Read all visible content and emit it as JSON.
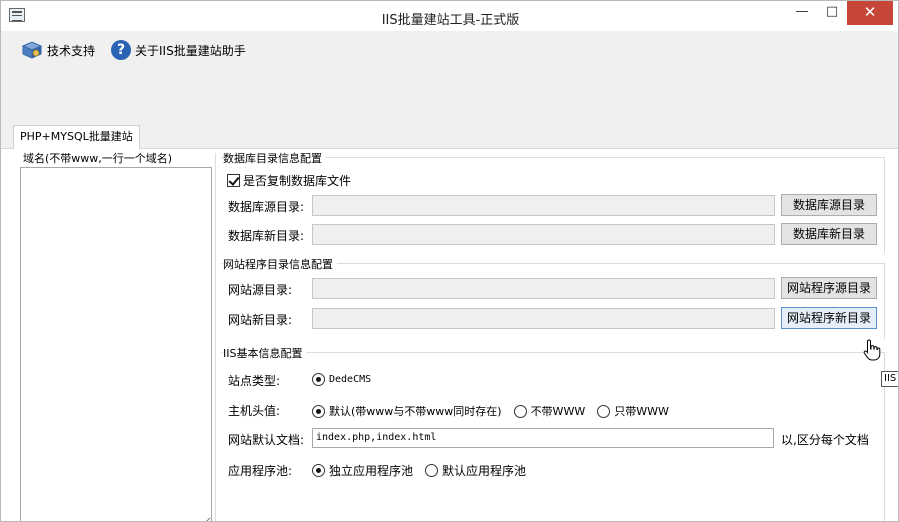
{
  "window": {
    "title": "IIS批量建站工具-正式版",
    "controls": {
      "minimize": "—",
      "maximize": "□",
      "close": "✕"
    }
  },
  "toolbar": {
    "support_label": "技术支持",
    "about_label": "关于IIS批量建站助手"
  },
  "tabs": [
    {
      "label": "PHP+MYSQL批量建站",
      "active": true
    }
  ],
  "domains": {
    "label": "域名(不带www,一行一个域名)",
    "value": ""
  },
  "db_group": {
    "title": "数据库目录信息配置",
    "copy_checkbox": {
      "label": "是否复制数据库文件",
      "checked": true
    },
    "source": {
      "label": "数据库源目录:",
      "value": "",
      "button": "数据库源目录"
    },
    "target": {
      "label": "数据库新目录:",
      "value": "",
      "button": "数据库新目录"
    }
  },
  "site_group": {
    "title": "网站程序目录信息配置",
    "source": {
      "label": "网站源目录:",
      "value": "",
      "button": "网站程序源目录"
    },
    "target": {
      "label": "网站新目录:",
      "value": "",
      "button": "网站程序新目录"
    }
  },
  "iis_group": {
    "title": "IIS基本信息配置",
    "site_type": {
      "label": "站点类型:",
      "options": [
        {
          "label": "DedeCMS",
          "checked": true
        }
      ]
    },
    "host_header": {
      "label": "主机头值:",
      "options": [
        {
          "label": "默认(带www与不带www同时存在)",
          "checked": true
        },
        {
          "label": "不带WWW",
          "checked": false
        },
        {
          "label": "只带WWW",
          "checked": false
        }
      ]
    },
    "default_doc": {
      "label": "网站默认文档:",
      "value": "index.php,index.html",
      "hint": "以,区分每个文档"
    },
    "app_pool": {
      "label": "应用程序池:",
      "options": [
        {
          "label": "独立应用程序池",
          "checked": true
        },
        {
          "label": "默认应用程序池",
          "checked": false
        }
      ]
    }
  },
  "tooltip": {
    "text": "IIS"
  },
  "colors": {
    "close_button": "#c7463a",
    "toolbar_bg": "#f0f0f0",
    "help_icon": "#2a62b4"
  }
}
